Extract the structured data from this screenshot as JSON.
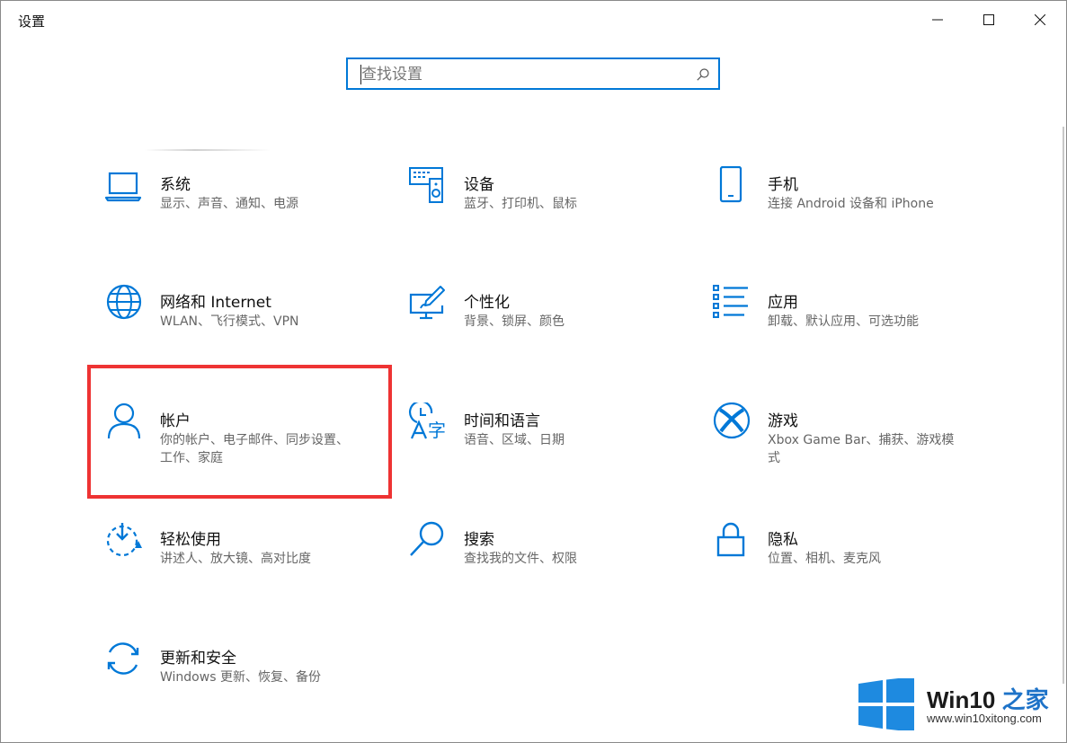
{
  "window": {
    "title": "设置"
  },
  "search": {
    "placeholder": "查找设置"
  },
  "colors": {
    "accent": "#0078d7",
    "highlight": "#ee3333"
  },
  "tiles": [
    {
      "title": "系统",
      "subtitle": "显示、声音、通知、电源",
      "icon": "laptop-icon"
    },
    {
      "title": "设备",
      "subtitle": "蓝牙、打印机、鼠标",
      "icon": "devices-icon"
    },
    {
      "title": "手机",
      "subtitle": "连接 Android 设备和 iPhone",
      "icon": "phone-icon"
    },
    {
      "title": "网络和 Internet",
      "subtitle": "WLAN、飞行模式、VPN",
      "icon": "globe-icon"
    },
    {
      "title": "个性化",
      "subtitle": "背景、锁屏、颜色",
      "icon": "personalize-icon"
    },
    {
      "title": "应用",
      "subtitle": "卸载、默认应用、可选功能",
      "icon": "apps-list-icon"
    },
    {
      "title": "帐户",
      "subtitle": "你的帐户、电子邮件、同步设置、工作、家庭",
      "icon": "person-icon"
    },
    {
      "title": "时间和语言",
      "subtitle": "语音、区域、日期",
      "icon": "time-language-icon"
    },
    {
      "title": "游戏",
      "subtitle": "Xbox Game Bar、捕获、游戏模式",
      "icon": "xbox-icon"
    },
    {
      "title": "轻松使用",
      "subtitle": "讲述人、放大镜、高对比度",
      "icon": "ease-of-access-icon"
    },
    {
      "title": "搜索",
      "subtitle": "查找我的文件、权限",
      "icon": "search-icon"
    },
    {
      "title": "隐私",
      "subtitle": "位置、相机、麦克风",
      "icon": "lock-icon"
    },
    {
      "title": "更新和安全",
      "subtitle": "Windows 更新、恢复、备份",
      "icon": "update-icon"
    }
  ],
  "watermark": {
    "brand": "Win10",
    "brand_zh": "之家",
    "url": "www.win10xitong.com"
  }
}
